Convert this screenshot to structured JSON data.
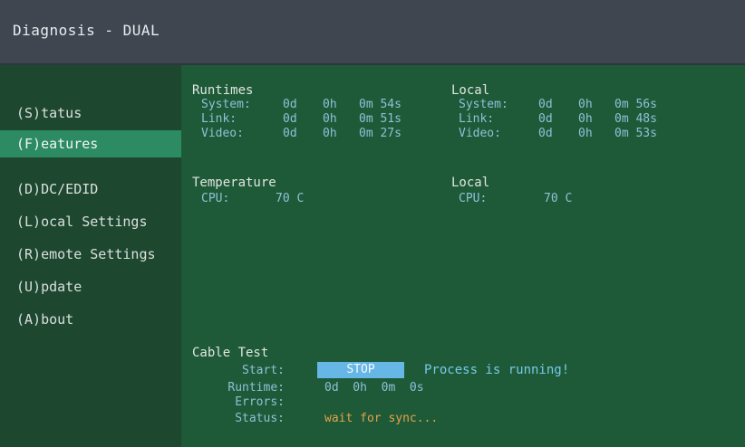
{
  "window": {
    "title": "Diagnosis - DUAL"
  },
  "sidebar": {
    "items": [
      {
        "label": "(S)tatus",
        "selected": false
      },
      {
        "label": "(F)eatures",
        "selected": true
      },
      {
        "label": "(D)DC/EDID",
        "selected": false
      },
      {
        "label": "(L)ocal Settings",
        "selected": false
      },
      {
        "label": "(R)emote Settings",
        "selected": false
      },
      {
        "label": "(U)pdate",
        "selected": false
      },
      {
        "label": "(A)bout",
        "selected": false
      }
    ]
  },
  "runtimes": {
    "remote": {
      "heading": "Runtimes",
      "rows": [
        {
          "label": "System:",
          "d": "0d",
          "h": "0h",
          "ms": "0m 54s"
        },
        {
          "label": "Link:",
          "d": "0d",
          "h": "0h",
          "ms": "0m 51s"
        },
        {
          "label": "Video:",
          "d": "0d",
          "h": "0h",
          "ms": "0m 27s"
        }
      ]
    },
    "local": {
      "heading": "Local",
      "rows": [
        {
          "label": "System:",
          "d": "0d",
          "h": "0h",
          "ms": "0m 56s"
        },
        {
          "label": "Link:",
          "d": "0d",
          "h": "0h",
          "ms": "0m 48s"
        },
        {
          "label": "Video:",
          "d": "0d",
          "h": "0h",
          "ms": "0m 53s"
        }
      ]
    }
  },
  "temperature": {
    "remote": {
      "heading": "Temperature",
      "label": "CPU:",
      "value": "70 C"
    },
    "local": {
      "heading": "Local",
      "label": "CPU:",
      "value": "70 C"
    }
  },
  "cable_test": {
    "heading": "Cable Test",
    "start_label": "Start:",
    "stop_button": "STOP",
    "running_msg": "Process is running!",
    "runtime_label": "Runtime:",
    "runtime_value": "0d  0h  0m  0s",
    "errors_label": "Errors:",
    "errors_value": "",
    "status_label": "Status:",
    "status_value": "wait for sync..."
  },
  "colors": {
    "title_bar": "#3f4650",
    "sidebar_bg": "#1e472f",
    "main_bg": "#1f5a38",
    "selected_item": "#2c8b63",
    "button_bg": "#66b6e6",
    "value_text": "#8fc0d8",
    "warning_text": "#e4a24a"
  }
}
